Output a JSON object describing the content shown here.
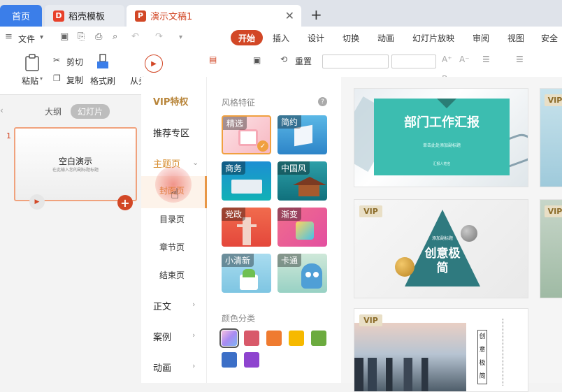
{
  "tabs": {
    "home": "首页",
    "template": "稻壳模板",
    "document": "演示文稿1"
  },
  "menu": {
    "file": "文件"
  },
  "ribbon_tabs": [
    "开始",
    "插入",
    "设计",
    "切换",
    "动画",
    "幻灯片放映",
    "审阅",
    "视图",
    "安全"
  ],
  "ribbon": {
    "paste": "粘贴",
    "cut": "剪切",
    "copy": "复制",
    "format_painter": "格式刷",
    "from_start": "从头",
    "reset": "重置"
  },
  "view_tabs": {
    "outline": "大纲",
    "slides": "幻灯片"
  },
  "slide": {
    "number": "1",
    "title": "空白演示",
    "subtitle": "在此输入您的副标题标题"
  },
  "category_menu": {
    "vip": "VIP特权",
    "recommend": "推荐专区",
    "theme": "主题页",
    "cover": "封面页",
    "toc": "目录页",
    "chapter": "章节页",
    "ending": "结束页",
    "body": "正文",
    "cases": "案例",
    "animation": "动画"
  },
  "style_panel": {
    "title": "风格特征",
    "help": "?",
    "styles": [
      "精选",
      "简约",
      "商务",
      "中国风",
      "党政",
      "渐变",
      "小清新",
      "卡通"
    ],
    "color_title": "颜色分类"
  },
  "colors": [
    "#c8a8ef",
    "#d8596a",
    "#ef7b30",
    "#f6b900",
    "#6cab3f",
    "#3c6fc7",
    "#8e44cf"
  ],
  "templates": {
    "t1_title": "部门工作汇报",
    "t1_sub": "单击此处添加副标题",
    "t1_note": "汇报人姓名",
    "t2_small": "添加副标题",
    "t2_title_1": "创意极",
    "t2_title_2": "简",
    "t3_chars": [
      "创",
      "意",
      "极",
      "简"
    ],
    "vip": "VIP"
  }
}
